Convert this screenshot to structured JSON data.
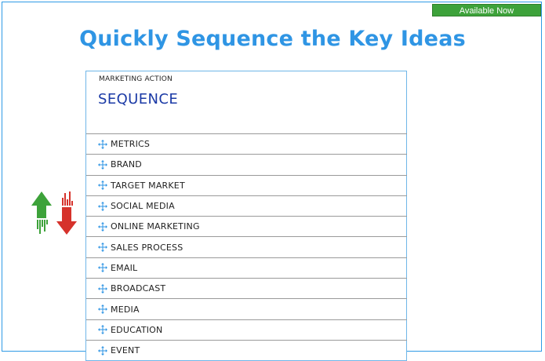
{
  "header": {
    "available_label": "Available Now"
  },
  "hero": {
    "title": "Quickly Sequence the Key Ideas"
  },
  "panel": {
    "kicker": "MARKETING ACTION",
    "heading": "SEQUENCE",
    "items": [
      {
        "label": "METRICS",
        "icon": "move-icon"
      },
      {
        "label": "BRAND",
        "icon": "move-icon"
      },
      {
        "label": "TARGET MARKET",
        "icon": "move-icon"
      },
      {
        "label": "SOCIAL MEDIA",
        "icon": "move-icon"
      },
      {
        "label": "ONLINE MARKETING",
        "icon": "move-icon"
      },
      {
        "label": "SALES PROCESS",
        "icon": "move-icon"
      },
      {
        "label": "EMAIL",
        "icon": "move-icon"
      },
      {
        "label": "BROADCAST",
        "icon": "move-icon"
      },
      {
        "label": "MEDIA",
        "icon": "move-icon"
      },
      {
        "label": "EDUCATION",
        "icon": "move-icon"
      },
      {
        "label": "EVENT",
        "icon": "move-icon"
      }
    ]
  },
  "decoration": {
    "icon": "sort-arrows-icon",
    "up_color": "#3da23a",
    "down_color": "#d6322b"
  },
  "colors": {
    "accent": "#2f95e4",
    "heading": "#1b3aa6",
    "button": "#3da23a"
  }
}
